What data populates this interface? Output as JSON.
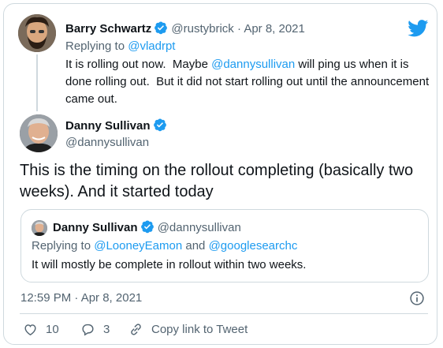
{
  "parent_tweet": {
    "author_name": "Barry Schwartz",
    "handle": "@rustybrick",
    "separator": " · ",
    "date": "Apr 8, 2021",
    "replying_to_prefix": "Replying to ",
    "replying_to": "@vladrpt",
    "text_part1": "It is rolling out now.  Maybe ",
    "mention": "@dannysullivan",
    "text_part2": " will ping us when it is done rolling out.  But it did not start rolling out until the announcement came out."
  },
  "main_tweet": {
    "author_name": "Danny Sullivan",
    "handle": "@dannysullivan",
    "text": "This is the timing on the rollout completing (basically two weeks). And it started today",
    "timestamp": "12:59 PM · Apr 8, 2021"
  },
  "quoted_tweet": {
    "author_name": "Danny Sullivan",
    "handle": "@dannysullivan",
    "replying_to_prefix": "Replying to ",
    "replying_to_1": "@LooneyEamon",
    "replying_and": " and ",
    "replying_to_2": "@googlesearchc",
    "text": "It will mostly be complete in rollout within two weeks."
  },
  "actions": {
    "like_count": "10",
    "reply_count": "3",
    "copy_link_label": "Copy link to Tweet"
  },
  "icons": {
    "brand": "twitter-bird-icon",
    "verified": "verified-badge-icon",
    "info": "info-icon",
    "like": "heart-icon",
    "reply": "reply-bubble-icon",
    "copy": "link-icon"
  },
  "colors": {
    "accent": "#1d9bf0",
    "text": "#0f1419",
    "muted": "#536471",
    "border": "#cfd9de"
  }
}
